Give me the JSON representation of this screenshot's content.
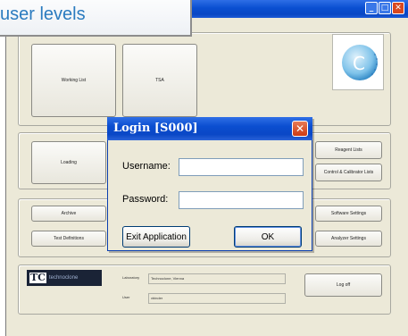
{
  "callout": {
    "text": "user levels"
  },
  "window": {
    "controls": {
      "minimize": "_",
      "maximize": "□",
      "close": "✕"
    }
  },
  "buttons": {
    "working_list": "Working List",
    "tsa": "TSA",
    "loading": "Loading",
    "archive": "Archive",
    "test_definitions": "Test Definitions",
    "reagent_lists": "Reagent Lists",
    "control_calibrator_lists": "Control & Calibrator Lists",
    "software_settings": "Software Settings",
    "analyzer_settings": "Analyzer Settings",
    "log_off": "Log off"
  },
  "footer": {
    "logo_mark": "TC",
    "logo_text": "technoclone",
    "laboratory_label": "Laboratory",
    "laboratory_value": "Technoclone, Vienna",
    "user_label": "User",
    "user_value": "vbinder"
  },
  "dialog": {
    "title": "Login   [S000]",
    "close": "✕",
    "username_label": "Username:",
    "username_value": "",
    "password_label": "Password:",
    "password_value": "",
    "exit_label": "Exit Application",
    "ok_label": "OK"
  },
  "colors": {
    "titlebar": "#0a4fd1",
    "window_bg": "#ece9d8",
    "callout_text": "#2a7bbf",
    "dialog_close": "#cd3b14"
  }
}
